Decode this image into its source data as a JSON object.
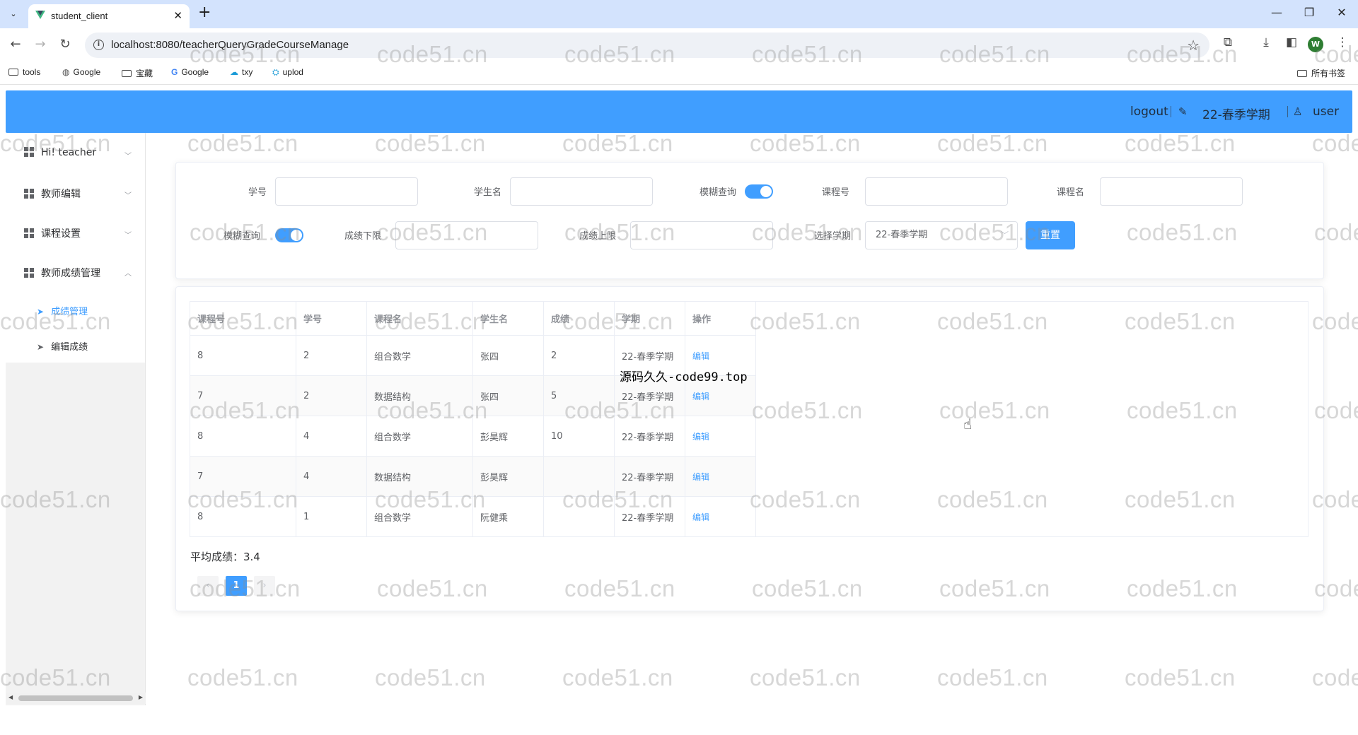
{
  "browser": {
    "tab_title": "student_client",
    "url": "localhost:8080/teacherQueryGradeCourseManage",
    "bookmarks": [
      "tools",
      "Google",
      "宝藏",
      "Google",
      "txy",
      "uplod"
    ],
    "all_bookmarks": "所有书签",
    "profile_initial": "W"
  },
  "header": {
    "logout": "logout",
    "term": "22-春季学期",
    "user": "user",
    "bg_color": "#409eff"
  },
  "sidebar": {
    "menus": [
      {
        "label": "Hi! teacher",
        "icon": "grid-icon"
      },
      {
        "label": "教师编辑",
        "icon": "grid-icon"
      },
      {
        "label": "课程设置",
        "icon": "grid-icon"
      },
      {
        "label": "教师成绩管理",
        "icon": "grid-icon"
      }
    ],
    "submenus": [
      {
        "label": "成绩管理",
        "active": true
      },
      {
        "label": "编辑成绩",
        "active": false
      }
    ]
  },
  "filters": {
    "student_id_label": "学号",
    "student_name_label": "学生名",
    "fuzzy_label": "模糊查询",
    "course_id_label": "课程号",
    "course_name_label": "课程名",
    "fuzzy_label_2": "模糊查询",
    "grade_min_label": "成绩下限",
    "grade_max_label": "成绩上限",
    "term_label": "选择学期",
    "term_value": "22-春季学期",
    "reset_button": "重置"
  },
  "table": {
    "headers": [
      "课程号",
      "学号",
      "课程名",
      "学生名",
      "成绩",
      "学期",
      "操作"
    ],
    "rows": [
      [
        "8",
        "2",
        "组合数学",
        "张四",
        "2",
        "22-春季学期",
        "编辑"
      ],
      [
        "7",
        "2",
        "数据结构",
        "张四",
        "5",
        "22-春季学期",
        "编辑"
      ],
      [
        "8",
        "4",
        "组合数学",
        "彭昊辉",
        "10",
        "22-春季学期",
        "编辑"
      ],
      [
        "7",
        "4",
        "数据结构",
        "彭昊辉",
        "",
        "22-春季学期",
        "编辑"
      ],
      [
        "8",
        "1",
        "组合数学",
        "阮健乘",
        "",
        "22-春季学期",
        "编辑"
      ]
    ]
  },
  "average": "平均成绩：3.4",
  "pagination": {
    "prev": "‹",
    "current": "1",
    "next": "›"
  },
  "overlay": "源码久久-code99.top",
  "watermark": "code51.cn"
}
